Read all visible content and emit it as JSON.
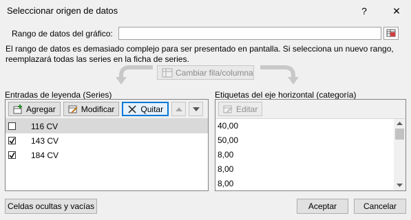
{
  "window": {
    "title": "Seleccionar origen de datos",
    "help_label": "?",
    "close_label": "✕"
  },
  "range": {
    "label": "Rango de datos del gráfico:",
    "value": ""
  },
  "message": {
    "line1": "El rango de datos es demasiado complejo para ser presentado en pantalla. Si selecciona un nuevo rango,",
    "line2": "reemplazará todas las series en la ficha de series."
  },
  "switch_button": "Cambiar fila/columna",
  "legend": {
    "title": "Entradas de leyenda (Series)",
    "add": "Agregar",
    "edit": "Modificar",
    "remove": "Quitar",
    "series": [
      {
        "label": "116 CV",
        "checked": false
      },
      {
        "label": "143 CV",
        "checked": true
      },
      {
        "label": "184 CV",
        "checked": true
      }
    ]
  },
  "axis": {
    "title": "Etiquetas del eje horizontal (categoría)",
    "edit": "Editar",
    "categories": [
      "40,00",
      "50,00",
      "8,00",
      "8,00",
      "8,00"
    ]
  },
  "footer": {
    "hidden_cells": "Celdas ocultas y vacías",
    "ok": "Aceptar",
    "cancel": "Cancelar"
  },
  "colors": {
    "focus_blue": "#0078d7",
    "selected_row": "#d9d9d9",
    "scroll_thumb": "#c2c2c2"
  }
}
